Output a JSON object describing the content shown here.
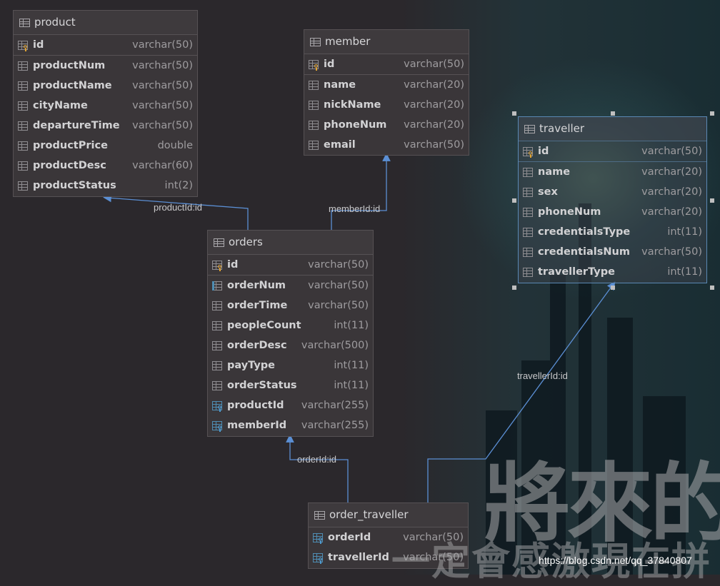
{
  "tables": {
    "product": {
      "name": "product",
      "columns": [
        {
          "name": "id",
          "type": "varchar(50)",
          "icon": "primary-key-icon"
        },
        {
          "name": "productNum",
          "type": "varchar(50)",
          "icon": "column-icon"
        },
        {
          "name": "productName",
          "type": "varchar(50)",
          "icon": "column-icon"
        },
        {
          "name": "cityName",
          "type": "varchar(50)",
          "icon": "column-icon"
        },
        {
          "name": "departureTime",
          "type": "varchar(50)",
          "icon": "column-icon"
        },
        {
          "name": "productPrice",
          "type": "double",
          "icon": "column-icon"
        },
        {
          "name": "productDesc",
          "type": "varchar(60)",
          "icon": "column-icon"
        },
        {
          "name": "productStatus",
          "type": "int(2)",
          "icon": "column-icon"
        }
      ]
    },
    "member": {
      "name": "member",
      "columns": [
        {
          "name": "id",
          "type": "varchar(50)",
          "icon": "primary-key-icon"
        },
        {
          "name": "name",
          "type": "varchar(20)",
          "icon": "column-icon"
        },
        {
          "name": "nickName",
          "type": "varchar(20)",
          "icon": "column-icon"
        },
        {
          "name": "phoneNum",
          "type": "varchar(20)",
          "icon": "column-icon"
        },
        {
          "name": "email",
          "type": "varchar(50)",
          "icon": "column-icon"
        }
      ]
    },
    "orders": {
      "name": "orders",
      "columns": [
        {
          "name": "id",
          "type": "varchar(50)",
          "icon": "primary-key-icon"
        },
        {
          "name": "orderNum",
          "type": "varchar(50)",
          "icon": "indexed-column-icon"
        },
        {
          "name": "orderTime",
          "type": "varchar(50)",
          "icon": "column-icon"
        },
        {
          "name": "peopleCount",
          "type": "int(11)",
          "icon": "column-icon"
        },
        {
          "name": "orderDesc",
          "type": "varchar(500)",
          "icon": "column-icon"
        },
        {
          "name": "payType",
          "type": "int(11)",
          "icon": "column-icon"
        },
        {
          "name": "orderStatus",
          "type": "int(11)",
          "icon": "column-icon"
        },
        {
          "name": "productId",
          "type": "varchar(255)",
          "icon": "foreign-key-icon"
        },
        {
          "name": "memberId",
          "type": "varchar(255)",
          "icon": "foreign-key-icon"
        }
      ]
    },
    "traveller": {
      "name": "traveller",
      "columns": [
        {
          "name": "id",
          "type": "varchar(50)",
          "icon": "primary-key-icon"
        },
        {
          "name": "name",
          "type": "varchar(20)",
          "icon": "column-icon"
        },
        {
          "name": "sex",
          "type": "varchar(20)",
          "icon": "column-icon"
        },
        {
          "name": "phoneNum",
          "type": "varchar(20)",
          "icon": "column-icon"
        },
        {
          "name": "credentialsType",
          "type": "int(11)",
          "icon": "column-icon"
        },
        {
          "name": "credentialsNum",
          "type": "varchar(50)",
          "icon": "column-icon"
        },
        {
          "name": "travellerType",
          "type": "int(11)",
          "icon": "column-icon"
        }
      ]
    },
    "order_traveller": {
      "name": "order_traveller",
      "columns": [
        {
          "name": "orderId",
          "type": "varchar(50)",
          "icon": "primary-foreign-key-icon"
        },
        {
          "name": "travellerId",
          "type": "varchar(50)",
          "icon": "primary-foreign-key-icon"
        }
      ]
    }
  },
  "relations": [
    {
      "label": "productId:id",
      "from": "orders",
      "to": "product"
    },
    {
      "label": "memberId:id",
      "from": "orders",
      "to": "member"
    },
    {
      "label": "orderId:id",
      "from": "order_traveller",
      "to": "orders"
    },
    {
      "label": "travellerId:id",
      "from": "order_traveller",
      "to": "traveller"
    }
  ],
  "watermark": {
    "big": "將來的",
    "small": "一定會感激現在拼",
    "url": "https://blog.csdn.net/qq_37840807"
  },
  "colors": {
    "canvas": "#2b282c",
    "table_bg": "#3a3639",
    "link": "#5b8fd4",
    "primary_key": "#e0a331",
    "foreign_key": "#4f8db3",
    "selection": "#5a88b4"
  }
}
